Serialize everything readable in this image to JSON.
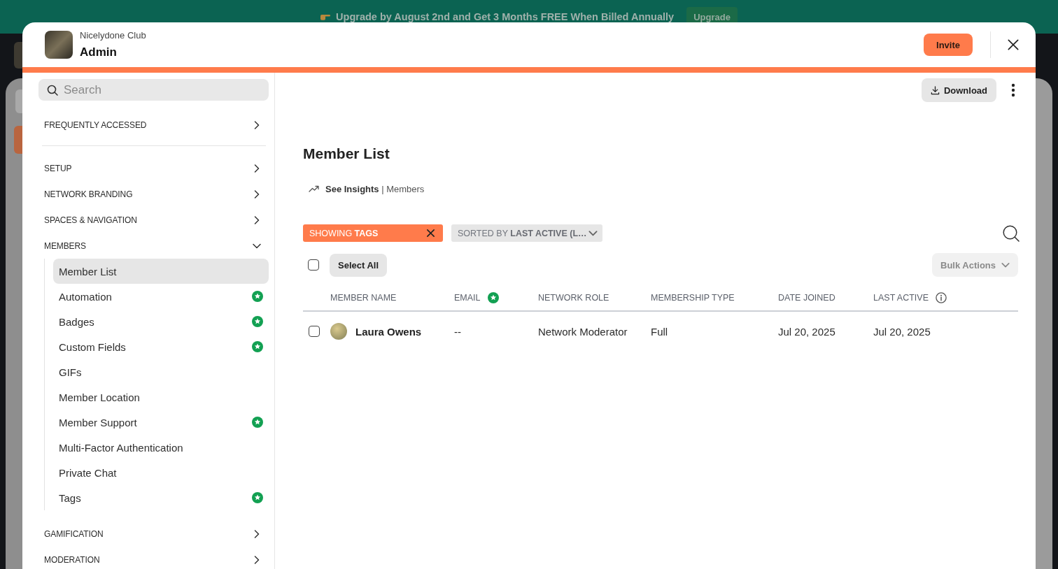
{
  "banner": {
    "text": "Upgrade by August 2nd and Get 3 Months FREE When Billed Annually",
    "button": "Upgrade"
  },
  "header": {
    "network_name": "Nicelydone Club",
    "title": "Admin",
    "invite_button": "Invite"
  },
  "sidebar": {
    "search": {
      "placeholder": "Search"
    },
    "pinned": {
      "label": "FREQUENTLY ACCESSED",
      "expanded": false
    },
    "sections": [
      {
        "label": "SETUP",
        "expanded": false
      },
      {
        "label": "NETWORK BRANDING",
        "expanded": false
      },
      {
        "label": "SPACES & NAVIGATION",
        "expanded": false
      },
      {
        "label": "MEMBERS",
        "expanded": true,
        "children": [
          {
            "label": "Member List",
            "selected": true,
            "premium_badge": false
          },
          {
            "label": "Automation",
            "selected": false,
            "premium_badge": true
          },
          {
            "label": "Badges",
            "selected": false,
            "premium_badge": true
          },
          {
            "label": "Custom Fields",
            "selected": false,
            "premium_badge": true
          },
          {
            "label": "GIFs",
            "selected": false,
            "premium_badge": false
          },
          {
            "label": "Member Location",
            "selected": false,
            "premium_badge": false
          },
          {
            "label": "Member Support",
            "selected": false,
            "premium_badge": true
          },
          {
            "label": "Multi-Factor Authentication",
            "selected": false,
            "premium_badge": false
          },
          {
            "label": "Private Chat",
            "selected": false,
            "premium_badge": false
          },
          {
            "label": "Tags",
            "selected": false,
            "premium_badge": true
          }
        ]
      },
      {
        "label": "GAMIFICATION",
        "expanded": false
      },
      {
        "label": "MODERATION",
        "expanded": false
      }
    ]
  },
  "main": {
    "download_button": "Download",
    "title": "Member List",
    "insights_link": "**See Insights** | Members",
    "filter_chip": "SHOWING **TAGS**",
    "sort_chip": "SORTED BY **LAST ACTIVE (L…**",
    "select_all": {
      "checked": false,
      "button": "Select All"
    },
    "bulk_actions_button": "Bulk Actions",
    "table": {
      "columns": [
        {
          "label": "MEMBER NAME",
          "premium_badge": false,
          "info_icon": false
        },
        {
          "label": "EMAIL",
          "premium_badge": true,
          "info_icon": false
        },
        {
          "label": "NETWORK ROLE",
          "premium_badge": false,
          "info_icon": false
        },
        {
          "label": "MEMBERSHIP TYPE",
          "premium_badge": false,
          "info_icon": false
        },
        {
          "label": "DATE JOINED",
          "premium_badge": false,
          "info_icon": false
        },
        {
          "label": "LAST ACTIVE",
          "premium_badge": false,
          "info_icon": true
        }
      ],
      "rows": [
        {
          "checked": false,
          "name": "Laura Owens",
          "email": "--",
          "network_role": "Network Moderator",
          "membership_type": "Full",
          "date_joined": "Jul 20, 2025",
          "last_active": "Jul 20, 2025"
        }
      ]
    }
  }
}
